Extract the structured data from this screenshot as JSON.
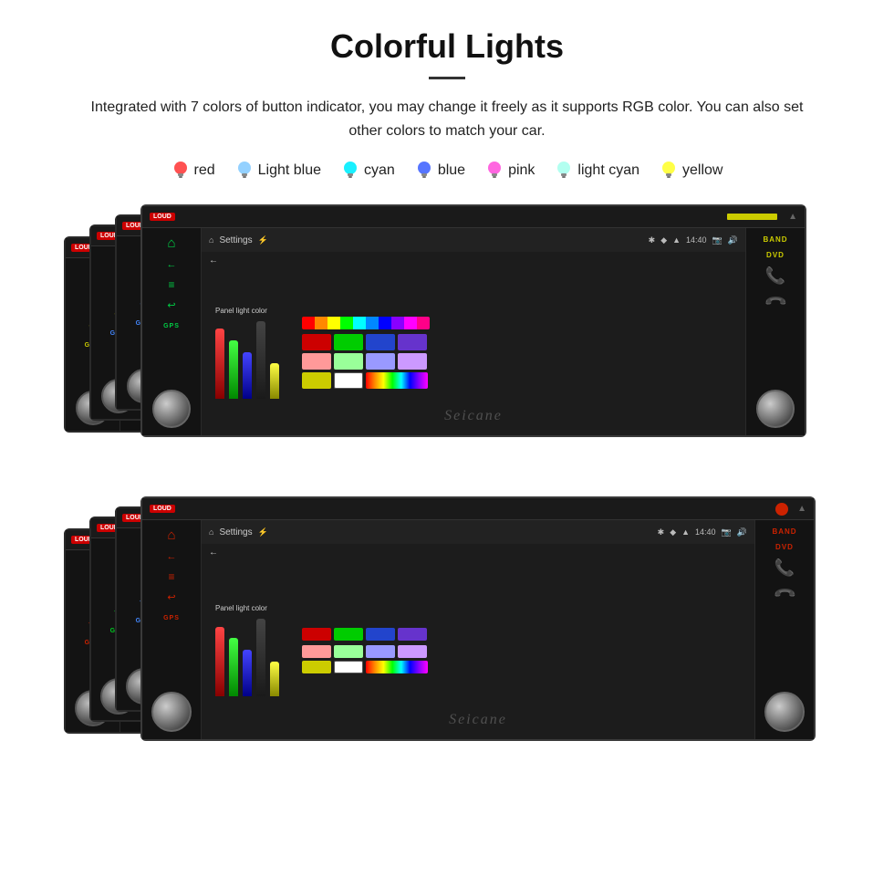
{
  "page": {
    "title": "Colorful Lights",
    "description": "Integrated with 7 colors of button indicator, you may change it freely as it supports RGB color. You can also set other colors to match your car.",
    "colors": [
      {
        "label": "red",
        "color": "#ff2222",
        "bulb_color": "#ff3333"
      },
      {
        "label": "Light blue",
        "color": "#aaddff",
        "bulb_color": "#88ccff"
      },
      {
        "label": "cyan",
        "color": "#00dddd",
        "bulb_color": "#00eeff"
      },
      {
        "label": "blue",
        "color": "#3355ff",
        "bulb_color": "#4466ff"
      },
      {
        "label": "pink",
        "color": "#ff44cc",
        "bulb_color": "#ff55dd"
      },
      {
        "label": "light cyan",
        "color": "#aaffff",
        "bulb_color": "#ccffff"
      },
      {
        "label": "yellow",
        "color": "#ffee00",
        "bulb_color": "#ffff33"
      }
    ],
    "watermark": "Seicane",
    "settings_label": "Settings",
    "panel_light_label": "Panel light color",
    "time": "14:40"
  }
}
